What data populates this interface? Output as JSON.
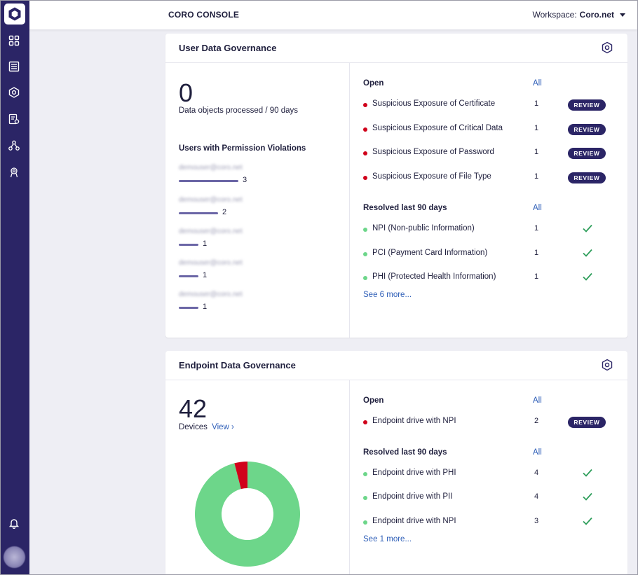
{
  "header": {
    "title": "CORO CONSOLE",
    "workspace_label": "Workspace:",
    "workspace_value": "Coro.net"
  },
  "sidebar": {
    "icons": [
      "dashboard-icon",
      "list-icon",
      "shield-hex-icon",
      "settings-doc-icon",
      "network-icon",
      "user-badge-icon"
    ],
    "bottom_icon": "bell-icon"
  },
  "user_data_governance": {
    "title": "User Data Governance",
    "processed_count": "0",
    "processed_label": "Data objects processed / 90 days",
    "violations_title": "Users with Permission Violations",
    "violations": [
      {
        "email": "demouser@coro.net",
        "count": "3",
        "fraction": 1.0
      },
      {
        "email": "demouser@coro.net",
        "count": "2",
        "fraction": 0.66
      },
      {
        "email": "demouser@coro.net",
        "count": "1",
        "fraction": 0.33
      },
      {
        "email": "demouser@coro.net",
        "count": "1",
        "fraction": 0.33
      },
      {
        "email": "demouser@coro.net",
        "count": "1",
        "fraction": 0.33
      }
    ],
    "open_title": "Open",
    "open_all": "All",
    "open_items": [
      {
        "label": "Suspicious Exposure of Certificate",
        "count": "1",
        "action": "REVIEW"
      },
      {
        "label": "Suspicious Exposure of Critical Data",
        "count": "1",
        "action": "REVIEW"
      },
      {
        "label": "Suspicious Exposure of Password",
        "count": "1",
        "action": "REVIEW"
      },
      {
        "label": "Suspicious Exposure of File Type",
        "count": "1",
        "action": "REVIEW"
      }
    ],
    "resolved_title": "Resolved last 90 days",
    "resolved_all": "All",
    "resolved_items": [
      {
        "label": "NPI (Non-public Information)",
        "count": "1"
      },
      {
        "label": "PCI (Payment Card Information)",
        "count": "1"
      },
      {
        "label": "PHI (Protected Health Information)",
        "count": "1"
      }
    ],
    "see_more": "See 6 more..."
  },
  "endpoint_data_governance": {
    "title": "Endpoint Data Governance",
    "devices_count": "42",
    "devices_label": "Devices",
    "view_link": "View ›",
    "donut": {
      "green_fraction": 0.96,
      "red_fraction": 0.04,
      "green": "#6dd68a",
      "red": "#d0021b"
    },
    "open_title": "Open",
    "open_all": "All",
    "open_items": [
      {
        "label": "Endpoint drive with NPI",
        "count": "2",
        "action": "REVIEW"
      }
    ],
    "resolved_title": "Resolved last 90 days",
    "resolved_all": "All",
    "resolved_items": [
      {
        "label": "Endpoint drive with PHI",
        "count": "4"
      },
      {
        "label": "Endpoint drive with PII",
        "count": "4"
      },
      {
        "label": "Endpoint drive with NPI",
        "count": "3"
      }
    ],
    "see_more": "See 1 more..."
  },
  "colors": {
    "sidebar": "#2b2566",
    "accent_link": "#2f5fb8",
    "open_dot": "#d0021b",
    "resolved_dot": "#6dd68a",
    "check": "#2e9e5b"
  }
}
